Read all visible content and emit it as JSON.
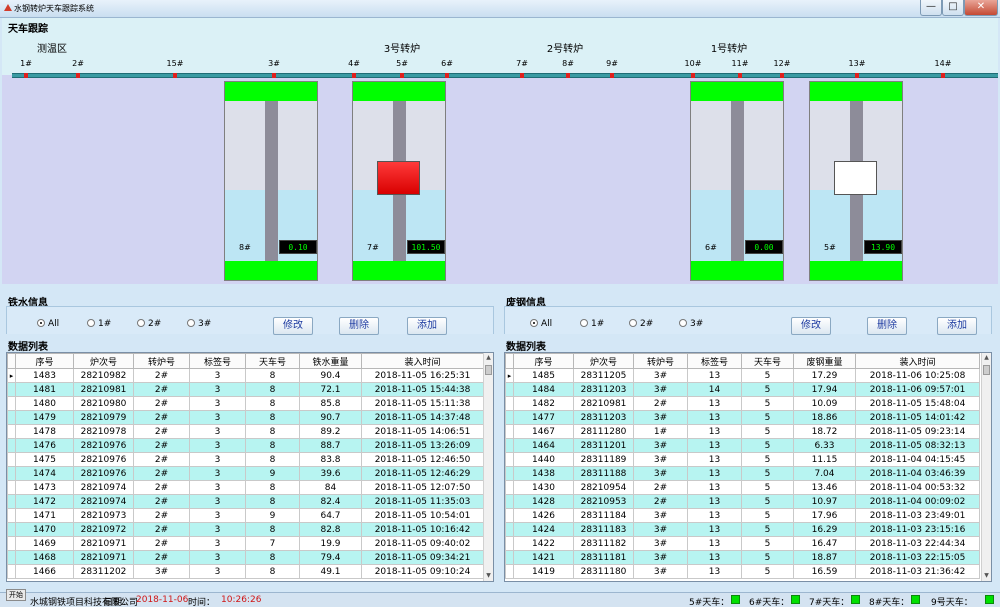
{
  "window": {
    "title": "水钢转炉天车跟踪系统",
    "min_glyph": "—",
    "max_glyph": "□",
    "close_glyph": "✕"
  },
  "crane_view": {
    "title": "天车跟踪",
    "areas": [
      {
        "id": "area-test",
        "label": "测温区"
      },
      {
        "id": "area-c3",
        "label": "3号转炉"
      },
      {
        "id": "area-c2",
        "label": "2号转炉"
      },
      {
        "id": "area-c1",
        "label": "1号转炉"
      }
    ],
    "posts": [
      "1#",
      "2#",
      "15#",
      "3#",
      "4#",
      "5#",
      "6#",
      "7#",
      "8#",
      "9#",
      "10#",
      "11#",
      "12#",
      "13#",
      "14#"
    ],
    "ladles": [
      {
        "label": "8#",
        "value": "0.10",
        "level": 0.44,
        "marker": "none"
      },
      {
        "label": "7#",
        "value": "101.50",
        "level": 0.44,
        "marker": "red"
      },
      {
        "label": "6#",
        "value": "0.00",
        "level": 0.44,
        "marker": "none"
      },
      {
        "label": "5#",
        "value": "13.90",
        "level": 0.44,
        "marker": "white"
      }
    ]
  },
  "iron_panel": {
    "title": "铁水信息",
    "filters": [
      {
        "label": "All",
        "checked": true
      },
      {
        "label": "1#",
        "checked": false
      },
      {
        "label": "2#",
        "checked": false
      },
      {
        "label": "3#",
        "checked": false
      }
    ],
    "buttons": {
      "edit": "修改",
      "delete": "删除",
      "add": "添加"
    },
    "list_title": "数据列表",
    "columns": [
      "序号",
      "炉次号",
      "转炉号",
      "标签号",
      "天车号",
      "铁水重量",
      "装入时间"
    ],
    "rows": [
      [
        "1483",
        "28210982",
        "2#",
        "3",
        "8",
        "90.4",
        "2018-11-05 16:25:31"
      ],
      [
        "1481",
        "28210981",
        "2#",
        "3",
        "8",
        "72.1",
        "2018-11-05 15:44:38"
      ],
      [
        "1480",
        "28210980",
        "2#",
        "3",
        "8",
        "85.8",
        "2018-11-05 15:11:38"
      ],
      [
        "1479",
        "28210979",
        "2#",
        "3",
        "8",
        "90.7",
        "2018-11-05 14:37:48"
      ],
      [
        "1478",
        "28210978",
        "2#",
        "3",
        "8",
        "89.2",
        "2018-11-05 14:06:51"
      ],
      [
        "1476",
        "28210976",
        "2#",
        "3",
        "8",
        "88.7",
        "2018-11-05 13:26:09"
      ],
      [
        "1475",
        "28210976",
        "2#",
        "3",
        "8",
        "83.8",
        "2018-11-05 12:46:50"
      ],
      [
        "1474",
        "28210976",
        "2#",
        "3",
        "9",
        "39.6",
        "2018-11-05 12:46:29"
      ],
      [
        "1473",
        "28210974",
        "2#",
        "3",
        "8",
        "84",
        "2018-11-05 12:07:50"
      ],
      [
        "1472",
        "28210974",
        "2#",
        "3",
        "8",
        "82.4",
        "2018-11-05 11:35:03"
      ],
      [
        "1471",
        "28210973",
        "2#",
        "3",
        "9",
        "64.7",
        "2018-11-05 10:54:01"
      ],
      [
        "1470",
        "28210972",
        "2#",
        "3",
        "8",
        "82.8",
        "2018-11-05 10:16:42"
      ],
      [
        "1469",
        "28210971",
        "2#",
        "3",
        "7",
        "19.9",
        "2018-11-05 09:40:02"
      ],
      [
        "1468",
        "28210971",
        "2#",
        "3",
        "8",
        "79.4",
        "2018-11-05 09:34:21"
      ],
      [
        "1466",
        "28311202",
        "3#",
        "3",
        "8",
        "49.1",
        "2018-11-05 09:10:24"
      ]
    ]
  },
  "scrap_panel": {
    "title": "废钢信息",
    "filters": [
      {
        "label": "All",
        "checked": true
      },
      {
        "label": "1#",
        "checked": false
      },
      {
        "label": "2#",
        "checked": false
      },
      {
        "label": "3#",
        "checked": false
      }
    ],
    "buttons": {
      "edit": "修改",
      "delete": "删除",
      "add": "添加"
    },
    "list_title": "数据列表",
    "columns": [
      "序号",
      "炉次号",
      "转炉号",
      "标签号",
      "天车号",
      "废钢重量",
      "装入时间"
    ],
    "rows": [
      [
        "1485",
        "28311205",
        "3#",
        "13",
        "5",
        "17.29",
        "2018-11-06 10:25:08"
      ],
      [
        "1484",
        "28311203",
        "3#",
        "14",
        "5",
        "17.94",
        "2018-11-06 09:57:01"
      ],
      [
        "1482",
        "28210981",
        "2#",
        "13",
        "5",
        "10.09",
        "2018-11-05 15:48:04"
      ],
      [
        "1477",
        "28311203",
        "3#",
        "13",
        "5",
        "18.86",
        "2018-11-05 14:01:42"
      ],
      [
        "1467",
        "28111280",
        "1#",
        "13",
        "5",
        "18.72",
        "2018-11-05 09:23:14"
      ],
      [
        "1464",
        "28311201",
        "3#",
        "13",
        "5",
        "6.33",
        "2018-11-05 08:32:13"
      ],
      [
        "1440",
        "28311189",
        "3#",
        "13",
        "5",
        "11.15",
        "2018-11-04 04:15:45"
      ],
      [
        "1438",
        "28311188",
        "3#",
        "13",
        "5",
        "7.04",
        "2018-11-04 03:46:39"
      ],
      [
        "1430",
        "28210954",
        "2#",
        "13",
        "5",
        "13.46",
        "2018-11-04 00:53:32"
      ],
      [
        "1428",
        "28210953",
        "2#",
        "13",
        "5",
        "10.97",
        "2018-11-04 00:09:02"
      ],
      [
        "1426",
        "28311184",
        "3#",
        "13",
        "5",
        "17.96",
        "2018-11-03 23:49:01"
      ],
      [
        "1424",
        "28311183",
        "3#",
        "13",
        "5",
        "16.29",
        "2018-11-03 23:15:16"
      ],
      [
        "1422",
        "28311182",
        "3#",
        "13",
        "5",
        "16.47",
        "2018-11-03 22:44:34"
      ],
      [
        "1421",
        "28311181",
        "3#",
        "13",
        "5",
        "18.87",
        "2018-11-03 22:15:05"
      ],
      [
        "1419",
        "28311180",
        "3#",
        "13",
        "5",
        "16.59",
        "2018-11-03 21:36:42"
      ]
    ]
  },
  "status_bar": {
    "start": "开始",
    "company": "水城钢铁项目科技有限公司",
    "date_label": "日期：",
    "date": "2018-11-06",
    "time_label": "时间：",
    "time": "10:26:26",
    "cranes": [
      "5#天车：",
      "6#天车：",
      "7#天车：",
      "8#天车：",
      "9号天车："
    ],
    "crane_status_color": "#00e000"
  }
}
